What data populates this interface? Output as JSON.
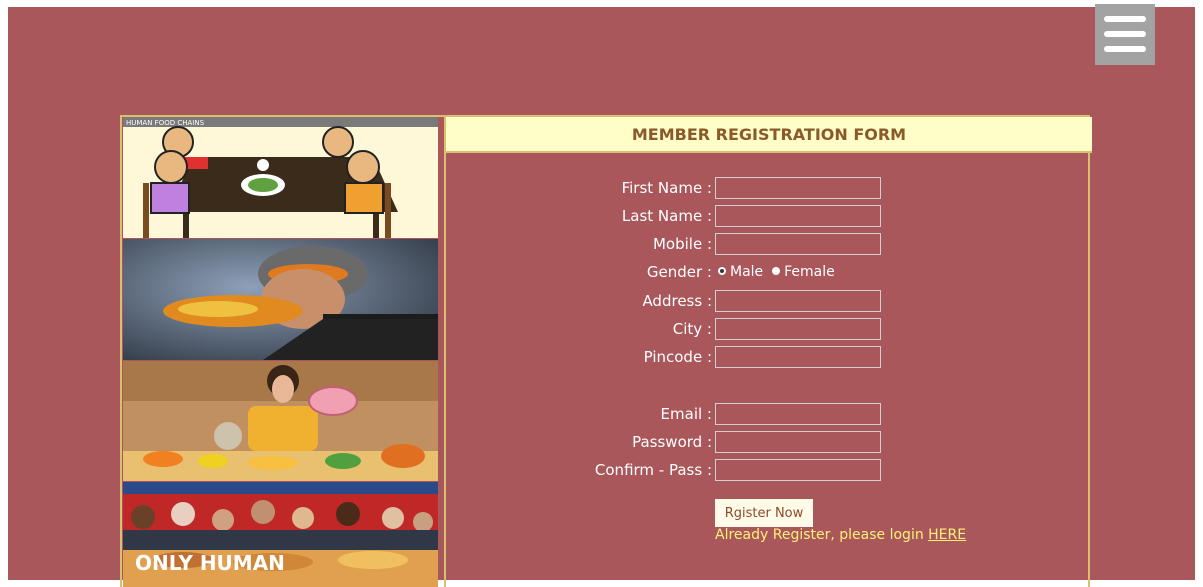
{
  "form": {
    "title": "MEMBER REGISTRATION FORM",
    "fields": {
      "first_name": "First Name :",
      "last_name": "Last Name :",
      "mobile": "Mobile :",
      "gender": "Gender :",
      "address": "Address :",
      "city": "City :",
      "pincode": "Pincode :",
      "email": "Email :",
      "password": "Password :",
      "confirm_pass": "Confirm - Pass :"
    },
    "gender_options": {
      "male": "Male",
      "female": "Female"
    },
    "submit_label": "Rgister Now",
    "login_prompt": "Already Register, please login",
    "login_link": "HERE"
  },
  "gallery": {
    "image1_caption": "HUMAN FOOD CHAINS",
    "image4_text": "ONLY HUMAN"
  },
  "colors": {
    "background": "#a9575a",
    "header_bg": "#fffdc8",
    "header_text": "#8a5a2a",
    "border": "#d8c070",
    "link": "#fff176"
  },
  "icons": {
    "menu": "hamburger-menu-icon"
  }
}
